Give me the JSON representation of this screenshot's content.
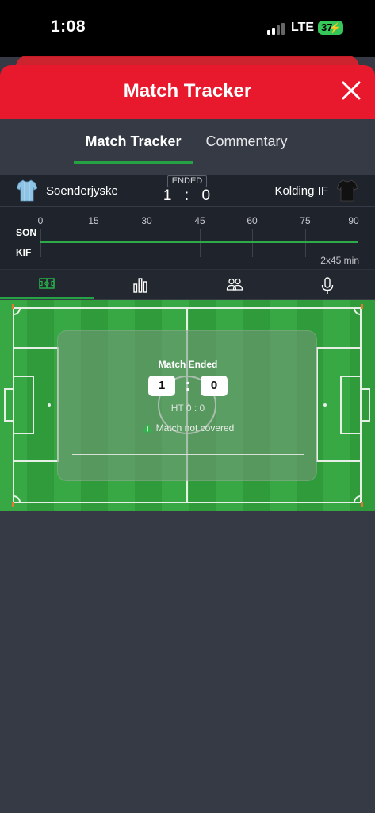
{
  "status_bar": {
    "time": "1:08",
    "network": "LTE",
    "battery": "37"
  },
  "header": {
    "title": "Match Tracker"
  },
  "tabs": [
    {
      "label": "Match Tracker",
      "active": true
    },
    {
      "label": "Commentary",
      "active": false
    }
  ],
  "match": {
    "home_team": "Soenderjyske",
    "away_team": "Kolding IF",
    "status": "ENDED",
    "home_score": "1",
    "separator": ":",
    "away_score": "0"
  },
  "timeline": {
    "ticks": [
      "0",
      "15",
      "30",
      "45",
      "60",
      "75",
      "90"
    ],
    "home_abbr": "SON",
    "away_abbr": "KIF",
    "duration": "2x45 min"
  },
  "icon_tabs": [
    {
      "icon": "pitch-icon",
      "active": true
    },
    {
      "icon": "stats-icon",
      "active": false
    },
    {
      "icon": "lineups-icon",
      "active": false
    },
    {
      "icon": "microphone-icon",
      "active": false
    }
  ],
  "overlay": {
    "title": "Match Ended",
    "home_score": "1",
    "separator": ":",
    "away_score": "0",
    "halftime": "HT  0 : 0",
    "note": "Match not covered"
  },
  "colors": {
    "brand_red": "#e8192c",
    "accent_green": "#25a244",
    "pitch_green": "#2f9b3a"
  }
}
